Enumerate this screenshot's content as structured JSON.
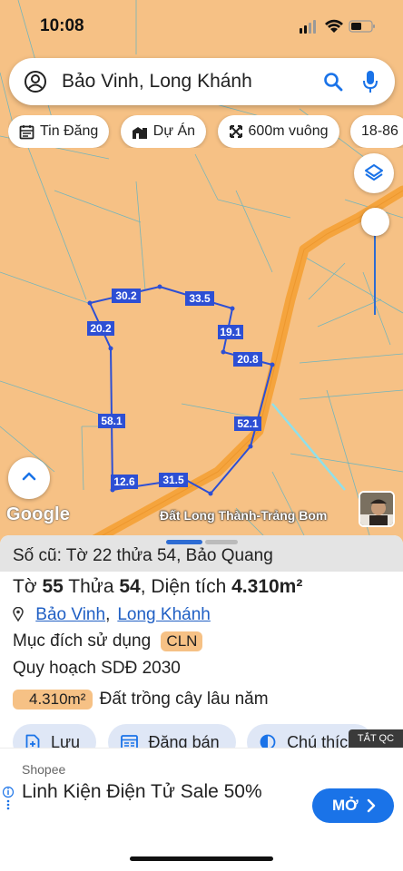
{
  "status_bar": {
    "time": "10:08"
  },
  "search": {
    "query": "Bảo Vinh, Long Khánh"
  },
  "chips": [
    {
      "label": "Tin Đăng",
      "icon": "calendar-icon"
    },
    {
      "label": "Dự Án",
      "icon": "buildings-icon"
    },
    {
      "label": "600m vuông",
      "icon": "resize-icon"
    },
    {
      "label": "18-86",
      "icon": ""
    }
  ],
  "map": {
    "google_label": "Google",
    "caption": "Đất Long Thành-Trảng Bom",
    "plot_edges": [
      "30.2",
      "33.5",
      "20.2",
      "19.1",
      "20.8",
      "58.1",
      "52.1",
      "12.6",
      "31.5"
    ],
    "plot_color": "#2d4fd4",
    "road_color": "#f5a43d"
  },
  "parcel": {
    "old_ref": "Số cũ: Tờ 22 thửa 54, Bảo Quang",
    "sheet_label": "Tờ",
    "sheet_no": "55",
    "plot_label": "Thửa",
    "plot_no": "54",
    "area_label": "Diện tích",
    "area_value": "4.310m²",
    "ward": "Bảo Vinh",
    "separator": ",",
    "city": "Long Khánh",
    "purpose_label": "Mục đích sử dụng",
    "purpose_code": "CLN",
    "plan": "Quy hoạch SDĐ 2030",
    "area_badge": "4.310m²",
    "land_type": "Đất trồng cây lâu năm"
  },
  "actions": [
    {
      "label": "Lưu",
      "icon": "save-doc-icon"
    },
    {
      "label": "Đăng bán",
      "icon": "listing-icon"
    },
    {
      "label": "Chú thích",
      "icon": "contrast-icon"
    }
  ],
  "ad": {
    "tag": "TẮT QC",
    "brand": "Shopee",
    "headline": "Linh Kiện Điện Tử Sale 50%",
    "cta": "MỞ",
    "cta_color": "#1a73e8"
  }
}
